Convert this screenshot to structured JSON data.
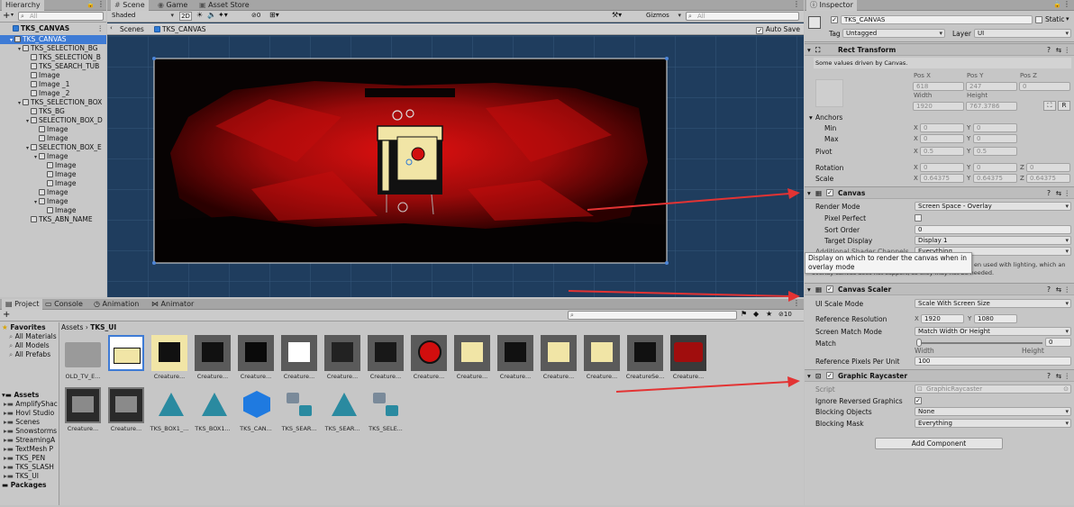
{
  "hierarchy": {
    "tab": "Hierarchy",
    "add_label": "+",
    "search_placeholder": "All",
    "scene_root": "TKS_CANVAS",
    "rows": [
      {
        "label": "TKS_CANVAS",
        "indent": 1,
        "arrow": "▾",
        "selected": true
      },
      {
        "label": "TKS_SELECTION_BG",
        "indent": 2,
        "arrow": "▾"
      },
      {
        "label": "TKS_SELECTION_B",
        "indent": 3,
        "arrow": ""
      },
      {
        "label": "TKS_SEARCH_TUB",
        "indent": 3,
        "arrow": ""
      },
      {
        "label": "Image",
        "indent": 3,
        "arrow": ""
      },
      {
        "label": "Image _1",
        "indent": 3,
        "arrow": ""
      },
      {
        "label": "Image _2",
        "indent": 3,
        "arrow": ""
      },
      {
        "label": "TKS_SELECTION_BOX",
        "indent": 2,
        "arrow": "▾"
      },
      {
        "label": "TKS_BG",
        "indent": 3,
        "arrow": ""
      },
      {
        "label": "SELECTION_BOX_D",
        "indent": 3,
        "arrow": "▾"
      },
      {
        "label": "Image",
        "indent": 4,
        "arrow": ""
      },
      {
        "label": "Image",
        "indent": 4,
        "arrow": ""
      },
      {
        "label": "SELECTION_BOX_E",
        "indent": 3,
        "arrow": "▾"
      },
      {
        "label": "Image",
        "indent": 4,
        "arrow": "▾"
      },
      {
        "label": "Image",
        "indent": 5,
        "arrow": ""
      },
      {
        "label": "Image",
        "indent": 5,
        "arrow": ""
      },
      {
        "label": "Image",
        "indent": 5,
        "arrow": ""
      },
      {
        "label": "Image",
        "indent": 4,
        "arrow": ""
      },
      {
        "label": "Image",
        "indent": 4,
        "arrow": "▾"
      },
      {
        "label": "Image",
        "indent": 5,
        "arrow": ""
      },
      {
        "label": "TKS_ABN_NAME",
        "indent": 3,
        "arrow": ""
      }
    ]
  },
  "scene": {
    "tabs": [
      "Scene",
      "Game",
      "Asset Store"
    ],
    "shading": "Shaded",
    "mode_2d": "2D",
    "hidden_count": "0",
    "gizmos": "Gizmos",
    "search_placeholder": "All",
    "breadcrumb_root": "Scenes",
    "breadcrumb_current": "TKS_CANVAS",
    "autosave_label": "Auto Save",
    "autosave_checked": "✓"
  },
  "project": {
    "tabs": [
      "Project",
      "Console",
      "Animation",
      "Animator"
    ],
    "add_label": "+",
    "count": "10",
    "favorites_label": "Favorites",
    "favorites": [
      "All Materials",
      "All Models",
      "All Prefabs"
    ],
    "assets_label": "Assets",
    "folders": [
      "AmplifyShac",
      "Hovl Studio",
      "Scenes",
      "Snowstorms",
      "StreamingA",
      "TextMesh P",
      "TKS_PEN",
      "TKS_SLASH",
      "TKS_UI"
    ],
    "packages_label": "Packages",
    "path_root": "Assets",
    "path_sep": "›",
    "path_current": "TKS_UI",
    "row1": [
      "OLD_TV_E...",
      "",
      "Creature...",
      "Creature...",
      "Creature...",
      "Creature...",
      "Creature...",
      "Creature...",
      "Creature...",
      "Creature...",
      "Creature...",
      "Creature...",
      "Creature...",
      "CreatureSe...",
      "Creature..."
    ],
    "row2": [
      "Creature...",
      "Creature...",
      "TKS_BOX1_...",
      "TKS_BOX1...",
      "TKS_CAN...",
      "TKS_SEAR...",
      "TKS_SEAR...",
      "TKS_SELE..."
    ]
  },
  "inspector": {
    "tab": "Inspector",
    "object_name": "TKS_CANVAS",
    "static_label": "Static",
    "tag_label": "Tag",
    "tag_value": "Untagged",
    "layer_label": "Layer",
    "layer_value": "UI",
    "rect_transform": {
      "title": "Rect Transform",
      "note": "Some values driven by Canvas.",
      "posx_label": "Pos X",
      "posx": "618",
      "posy_label": "Pos Y",
      "posy": "247",
      "posz_label": "Pos Z",
      "posz": "0",
      "width_label": "Width",
      "width": "1920",
      "height_label": "Height",
      "height": "767.3786",
      "anchors_label": "Anchors",
      "min_label": "Min",
      "max_label": "Max",
      "min_x": "0",
      "min_y": "0",
      "max_x": "0",
      "max_y": "0",
      "pivot_label": "Pivot",
      "pivot_x": "0.5",
      "pivot_y": "0.5",
      "rotation_label": "Rotation",
      "rot_x": "0",
      "rot_y": "0",
      "rot_z": "0",
      "scale_label": "Scale",
      "scale_x": "0.64375",
      "scale_y": "0.64375",
      "scale_z": "0.64375",
      "x": "X",
      "y": "Y",
      "z": "Z",
      "raw_btn": "R"
    },
    "canvas": {
      "title": "Canvas",
      "render_mode_label": "Render Mode",
      "render_mode": "Screen Space - Overlay",
      "pixel_perfect_label": "Pixel Perfect",
      "sort_order_label": "Sort Order",
      "sort_order": "0",
      "target_display_label": "Target Display",
      "target_display": "Display 1",
      "additional_label": "Additional Shader Channels",
      "additional_value": "Everything",
      "tooltip": "Display on which to render the canvas when in overlay mode",
      "warning_tail": "en used with lighting, which an",
      "warning_tail2": "overlay canvas does not support, so they may not be needed."
    },
    "canvas_scaler": {
      "title": "Canvas Scaler",
      "ui_scale_label": "UI Scale Mode",
      "ui_scale": "Scale With Screen Size",
      "ref_res_label": "Reference Resolution",
      "ref_x": "1920",
      "ref_y": "1080",
      "match_mode_label": "Screen Match Mode",
      "match_mode": "Match Width Or Height",
      "match_label": "Match",
      "match_value": "0",
      "match_fraction": 0,
      "width_label": "Width",
      "height_label": "Height",
      "ppu_label": "Reference Pixels Per Unit",
      "ppu": "100"
    },
    "raycaster": {
      "title": "Graphic Raycaster",
      "script_label": "Script",
      "script": "GraphicRaycaster",
      "ignore_label": "Ignore Reversed Graphics",
      "blocking_objects_label": "Blocking Objects",
      "blocking_objects": "None",
      "blocking_mask_label": "Blocking Mask",
      "blocking_mask": "Everything"
    },
    "add_component": "Add Component"
  },
  "colors": {
    "selection": "#3e7bd5",
    "scene_bg": "#1f3d5e",
    "arrow": "#e33333",
    "accent_red": "#d10e0e",
    "cream": "#f1e5a6"
  }
}
